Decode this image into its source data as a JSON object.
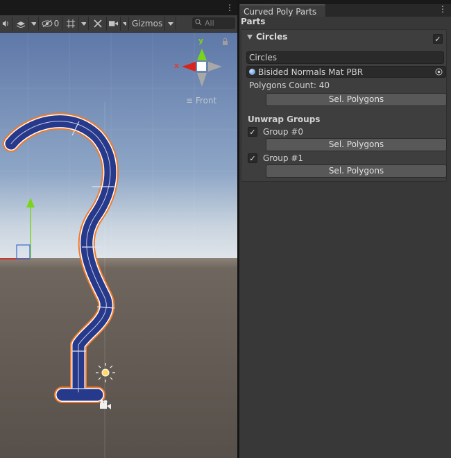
{
  "scene_view": {
    "toolbar": {
      "layers_count": "0",
      "gizmos_label": "Gizmos",
      "search_placeholder": "All"
    },
    "orientation_gizmo": {
      "y_label": "y",
      "x_label": "x",
      "view_label": "Front"
    }
  },
  "panel": {
    "tab_title": "Curved Poly Parts",
    "section_title": "Parts",
    "part": {
      "title": "Circles",
      "enabled": true,
      "name_value": "Circles",
      "material": "Bisided Normals Mat PBR",
      "polygons_count_label": "Polygons Count: 40",
      "sel_polygons_label": "Sel. Polygons"
    },
    "unwrap_groups": {
      "title": "Unwrap Groups",
      "groups": [
        {
          "label": "Group #0",
          "checked": true,
          "button": "Sel. Polygons"
        },
        {
          "label": "Group #1",
          "checked": true,
          "button": "Sel. Polygons"
        }
      ]
    }
  },
  "colors": {
    "selection_outline": "#f07a2a",
    "mesh_fill": "#2a3f8c",
    "axis_x": "#d9231d",
    "axis_y": "#7ad41a"
  }
}
